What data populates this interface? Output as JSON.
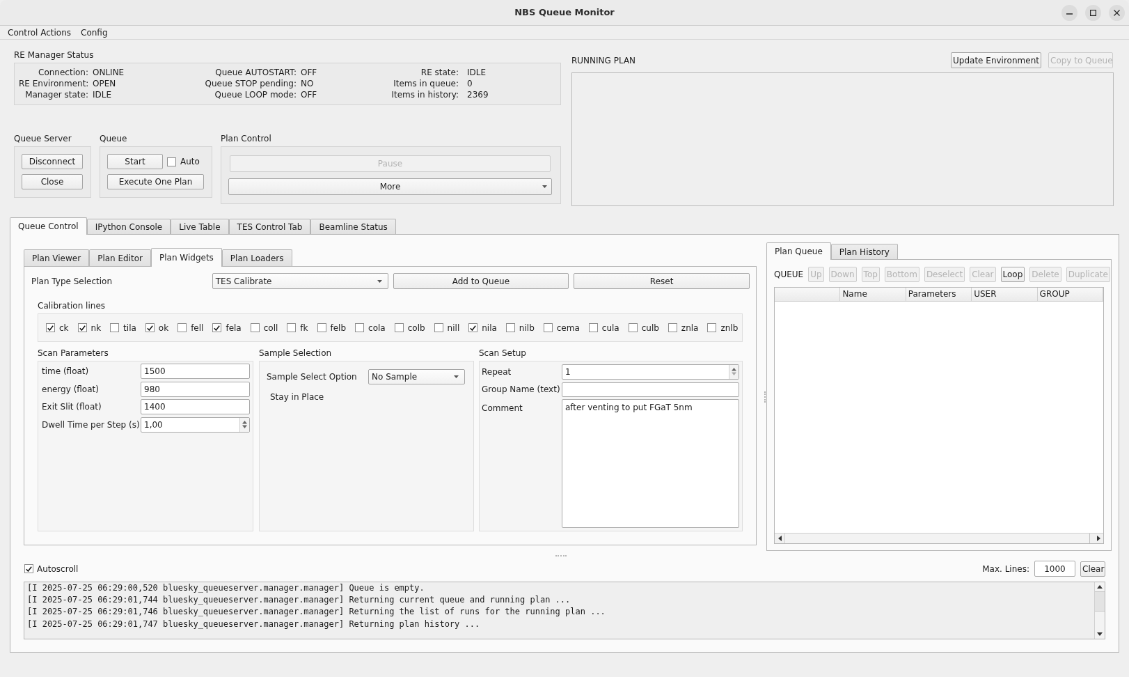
{
  "window": {
    "title": "NBS Queue Monitor"
  },
  "menu": [
    "Control Actions",
    "Config"
  ],
  "re_manager_status": {
    "title": "RE Manager Status",
    "columns": [
      [
        {
          "label": "Connection:",
          "value": "ONLINE"
        },
        {
          "label": "RE Environment:",
          "value": "OPEN"
        },
        {
          "label": "Manager state:",
          "value": "IDLE"
        }
      ],
      [
        {
          "label": "Queue AUTOSTART:",
          "value": "OFF"
        },
        {
          "label": "Queue STOP pending:",
          "value": "NO"
        },
        {
          "label": "Queue LOOP mode:",
          "value": "OFF"
        }
      ],
      [
        {
          "label": "RE state:",
          "value": "IDLE"
        },
        {
          "label": "Items in queue:",
          "value": "0"
        },
        {
          "label": "Items in history:",
          "value": "2369"
        }
      ]
    ]
  },
  "queue_server": {
    "title": "Queue Server",
    "disconnect": "Disconnect",
    "close": "Close"
  },
  "queue": {
    "title": "Queue",
    "start": "Start",
    "auto": {
      "label": "Auto",
      "checked": false
    },
    "execute": "Execute One Plan"
  },
  "plan_control": {
    "title": "Plan Control",
    "pause": {
      "label": "Pause",
      "disabled": true
    },
    "more": "More"
  },
  "running_plan": {
    "title": "RUNNING PLAN",
    "update_environment": {
      "label": "Update Environment",
      "disabled": false
    },
    "copy_to_queue": {
      "label": "Copy to Queue",
      "disabled": true
    }
  },
  "main_tabs": [
    {
      "label": "Queue Control",
      "selected": true
    },
    {
      "label": "IPython Console",
      "selected": false
    },
    {
      "label": "Live Table",
      "selected": false
    },
    {
      "label": "TES Control Tab",
      "selected": false
    },
    {
      "label": "Beamline Status",
      "selected": false
    }
  ],
  "plan_tabs": [
    {
      "label": "Plan Viewer",
      "selected": false
    },
    {
      "label": "Plan Editor",
      "selected": false
    },
    {
      "label": "Plan Widgets",
      "selected": true
    },
    {
      "label": "Plan Loaders",
      "selected": false
    }
  ],
  "plan_widgets": {
    "plan_type_label": "Plan Type Selection",
    "plan_type": "TES Calibrate",
    "add_to_queue": "Add to Queue",
    "reset": "Reset",
    "calibration": {
      "title": "Calibration lines",
      "lines": [
        {
          "label": "ck",
          "checked": true
        },
        {
          "label": "nk",
          "checked": true
        },
        {
          "label": "tila",
          "checked": false
        },
        {
          "label": "ok",
          "checked": true
        },
        {
          "label": "fell",
          "checked": false
        },
        {
          "label": "fela",
          "checked": true
        },
        {
          "label": "coll",
          "checked": false
        },
        {
          "label": "fk",
          "checked": false
        },
        {
          "label": "felb",
          "checked": false
        },
        {
          "label": "cola",
          "checked": false
        },
        {
          "label": "colb",
          "checked": false
        },
        {
          "label": "nill",
          "checked": false
        },
        {
          "label": "nila",
          "checked": true
        },
        {
          "label": "nilb",
          "checked": false
        },
        {
          "label": "cema",
          "checked": false
        },
        {
          "label": "cula",
          "checked": false
        },
        {
          "label": "culb",
          "checked": false
        },
        {
          "label": "znla",
          "checked": false
        },
        {
          "label": "znlb",
          "checked": false
        }
      ]
    },
    "scan_parameters": {
      "title": "Scan Parameters",
      "fields": [
        {
          "label": "time (float)",
          "value": "1500",
          "kind": "text"
        },
        {
          "label": "energy (float)",
          "value": "980",
          "kind": "text"
        },
        {
          "label": "Exit Slit (float)",
          "value": "1400",
          "kind": "text"
        },
        {
          "label": "Dwell Time per Step (s)",
          "value": "1,00",
          "kind": "spin"
        }
      ]
    },
    "sample_selection": {
      "title": "Sample Selection",
      "option_label": "Sample Select Option",
      "option": "No Sample",
      "note": "Stay in Place"
    },
    "scan_setup": {
      "title": "Scan Setup",
      "fields": [
        {
          "label": "Repeat",
          "value": "1",
          "kind": "spin"
        },
        {
          "label": "Group Name (text)",
          "kind": "text"
        },
        {
          "label": "Comment",
          "value": "after venting to put FGaT 5nm",
          "kind": "area"
        }
      ]
    }
  },
  "plan_queue": {
    "tabs": [
      {
        "label": "Plan Queue",
        "selected": true
      },
      {
        "label": "Plan History",
        "selected": false
      }
    ],
    "title": "QUEUE",
    "buttons": [
      {
        "label": "Up",
        "disabled": true
      },
      {
        "label": "Down",
        "disabled": true
      },
      {
        "label": "Top",
        "disabled": true
      },
      {
        "label": "Bottom",
        "disabled": true
      },
      {
        "label": "Deselect",
        "disabled": true
      },
      {
        "label": "Clear",
        "disabled": true
      },
      {
        "label": "Loop",
        "disabled": false
      },
      {
        "label": "Delete",
        "disabled": true
      },
      {
        "label": "Duplicate",
        "disabled": true
      }
    ],
    "table": {
      "columns": [
        "Name",
        "Parameters",
        "USER",
        "GROUP"
      ]
    }
  },
  "console": {
    "autoscroll": {
      "label": "Autoscroll",
      "checked": true
    },
    "max_lines_label": "Max. Lines:",
    "max_lines": "1000",
    "clear": "Clear",
    "lines": [
      "[I 2025-07-25 06:29:00,520 bluesky_queueserver.manager.manager] Queue is empty.",
      "[I 2025-07-25 06:29:01,744 bluesky_queueserver.manager.manager] Returning current queue and running plan ...",
      "[I 2025-07-25 06:29:01,746 bluesky_queueserver.manager.manager] Returning the list of runs for the running plan ...",
      "[I 2025-07-25 06:29:01,747 bluesky_queueserver.manager.manager] Returning plan history ..."
    ]
  }
}
